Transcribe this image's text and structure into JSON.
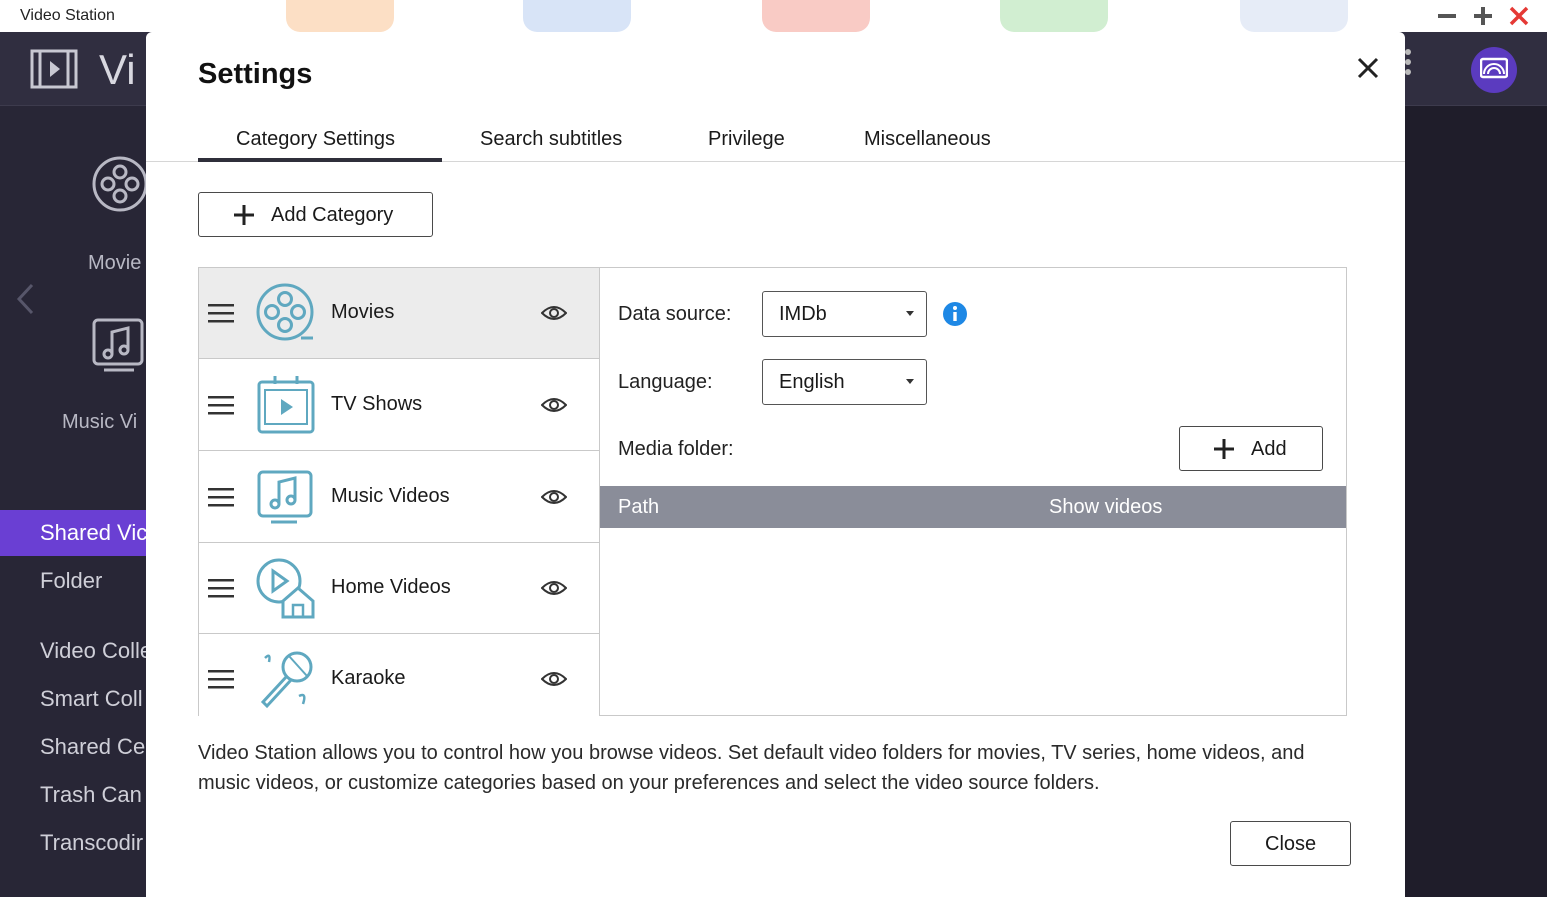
{
  "window": {
    "title": "Video Station"
  },
  "app": {
    "name": "Vi",
    "tiles": [
      {
        "label": "Movie"
      },
      {
        "label": "Music Vi"
      }
    ],
    "nav": [
      {
        "label": "Shared Vic",
        "active": true
      },
      {
        "label": "Folder"
      },
      {
        "label": "Video Colle"
      },
      {
        "label": "Smart Coll"
      },
      {
        "label": "Shared Ce"
      },
      {
        "label": "Trash Can"
      },
      {
        "label": "Transcodir"
      }
    ],
    "accent_color": "#6a3fd3"
  },
  "modal": {
    "title": "Settings",
    "tabs": [
      {
        "label": "Category Settings",
        "active": true
      },
      {
        "label": "Search subtitles"
      },
      {
        "label": "Privilege"
      },
      {
        "label": "Miscellaneous"
      }
    ],
    "add_category_label": "Add Category",
    "categories": [
      {
        "label": "Movies",
        "icon": "film-reel-icon",
        "selected": true
      },
      {
        "label": "TV Shows",
        "icon": "tv-play-icon"
      },
      {
        "label": "Music Videos",
        "icon": "music-video-icon"
      },
      {
        "label": "Home Videos",
        "icon": "home-video-icon"
      },
      {
        "label": "Karaoke",
        "icon": "microphone-icon"
      }
    ],
    "details": {
      "data_source_label": "Data source:",
      "data_source_value": "IMDb",
      "language_label": "Language:",
      "language_value": "English",
      "media_folder_label": "Media folder:",
      "add_label": "Add",
      "columns": [
        "Path",
        "Show videos"
      ]
    },
    "description": "Video Station allows you to control how you browse videos. Set default video folders for movies, TV series, home videos, and music videos, or customize categories based on your preferences and select the video source folders.",
    "close_label": "Close",
    "icon_color": "#5fa8c0",
    "info_color": "#1e88e5"
  }
}
